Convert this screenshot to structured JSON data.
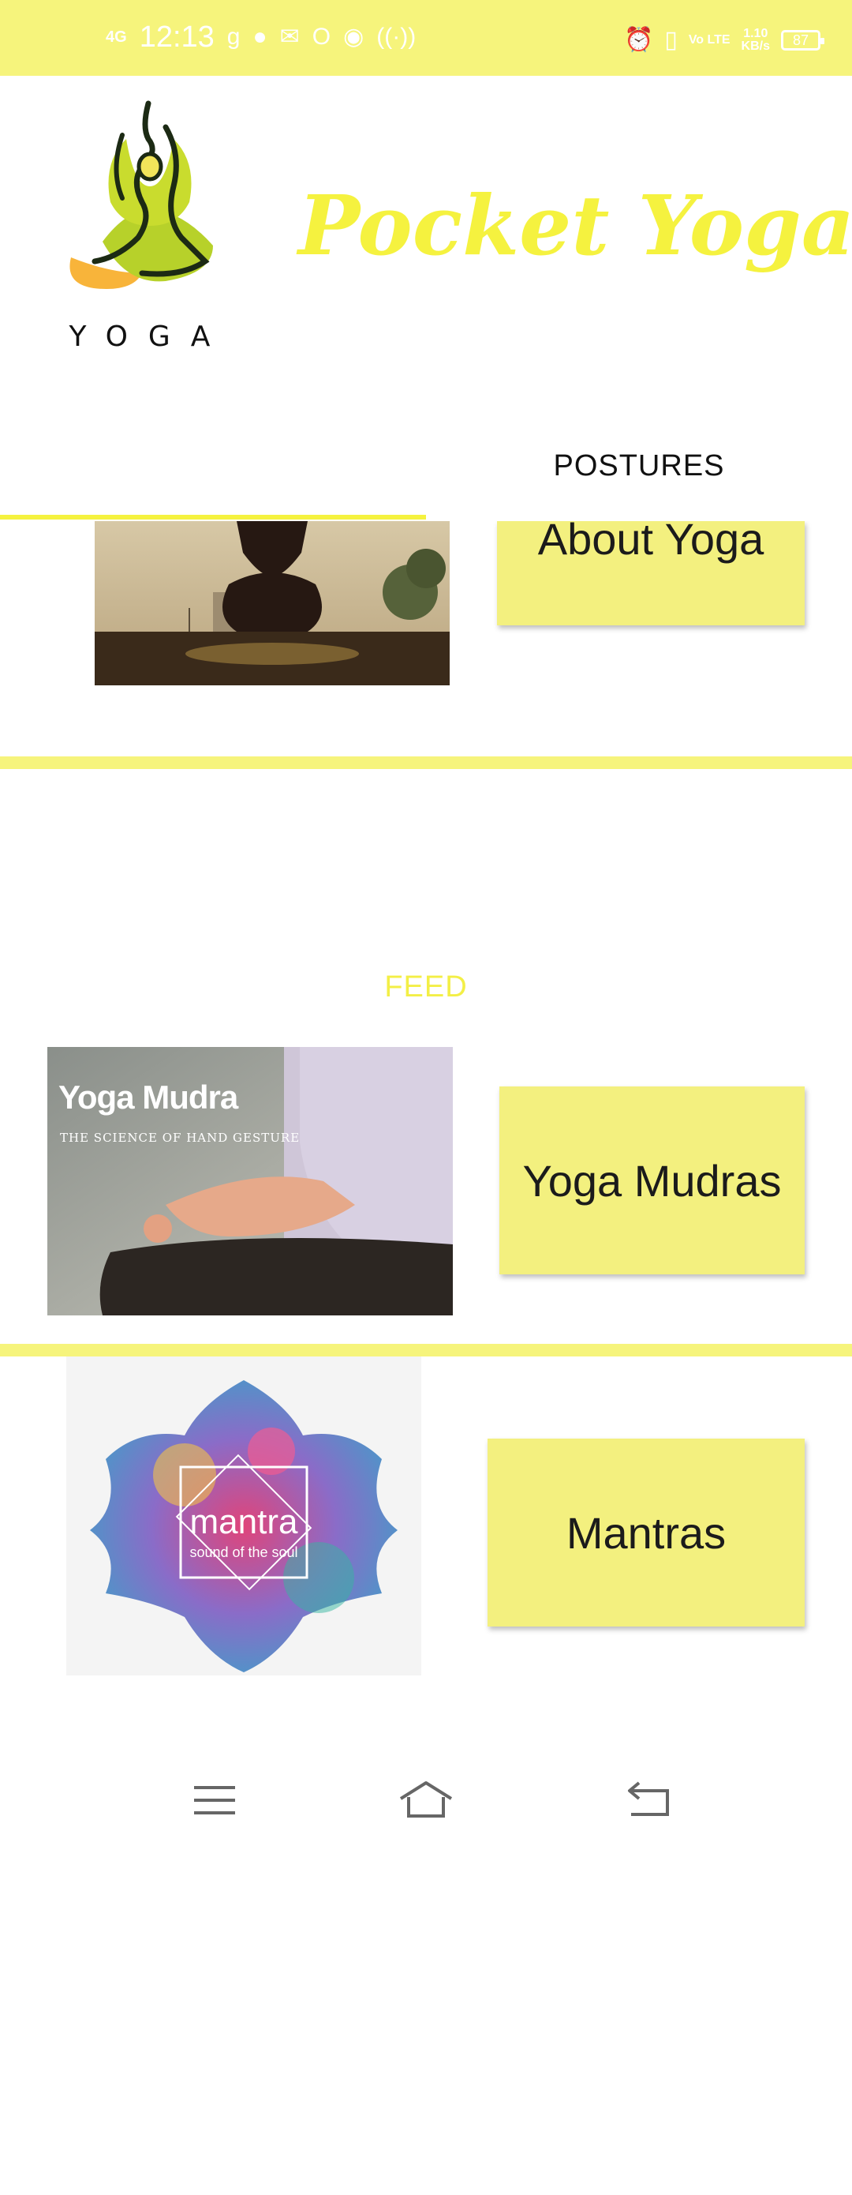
{
  "status_bar": {
    "network": "4G",
    "time": "12:13",
    "lte": "Vo LTE",
    "speed_value": "1.10",
    "speed_unit": "KB/s",
    "battery": "87"
  },
  "header": {
    "logo_text": "YOGA",
    "app_title": "Pocket Yoga"
  },
  "tabs": [
    {
      "label": "FEED",
      "selected": true
    },
    {
      "label": "POSTURES",
      "selected": false
    }
  ],
  "feed": {
    "items": [
      {
        "button_label": "About Yoga"
      },
      {
        "button_label": "Yoga Mudras",
        "image_title": "Yoga Mudra",
        "image_subtitle": "THE SCIENCE OF HAND GESTURE"
      },
      {
        "button_label": "Mantras",
        "image_title": "mantra",
        "image_subtitle": "sound of the soul"
      }
    ]
  },
  "colors": {
    "accent": "#f6f47c",
    "title": "#f5f23f",
    "card": "#f3f07f"
  }
}
